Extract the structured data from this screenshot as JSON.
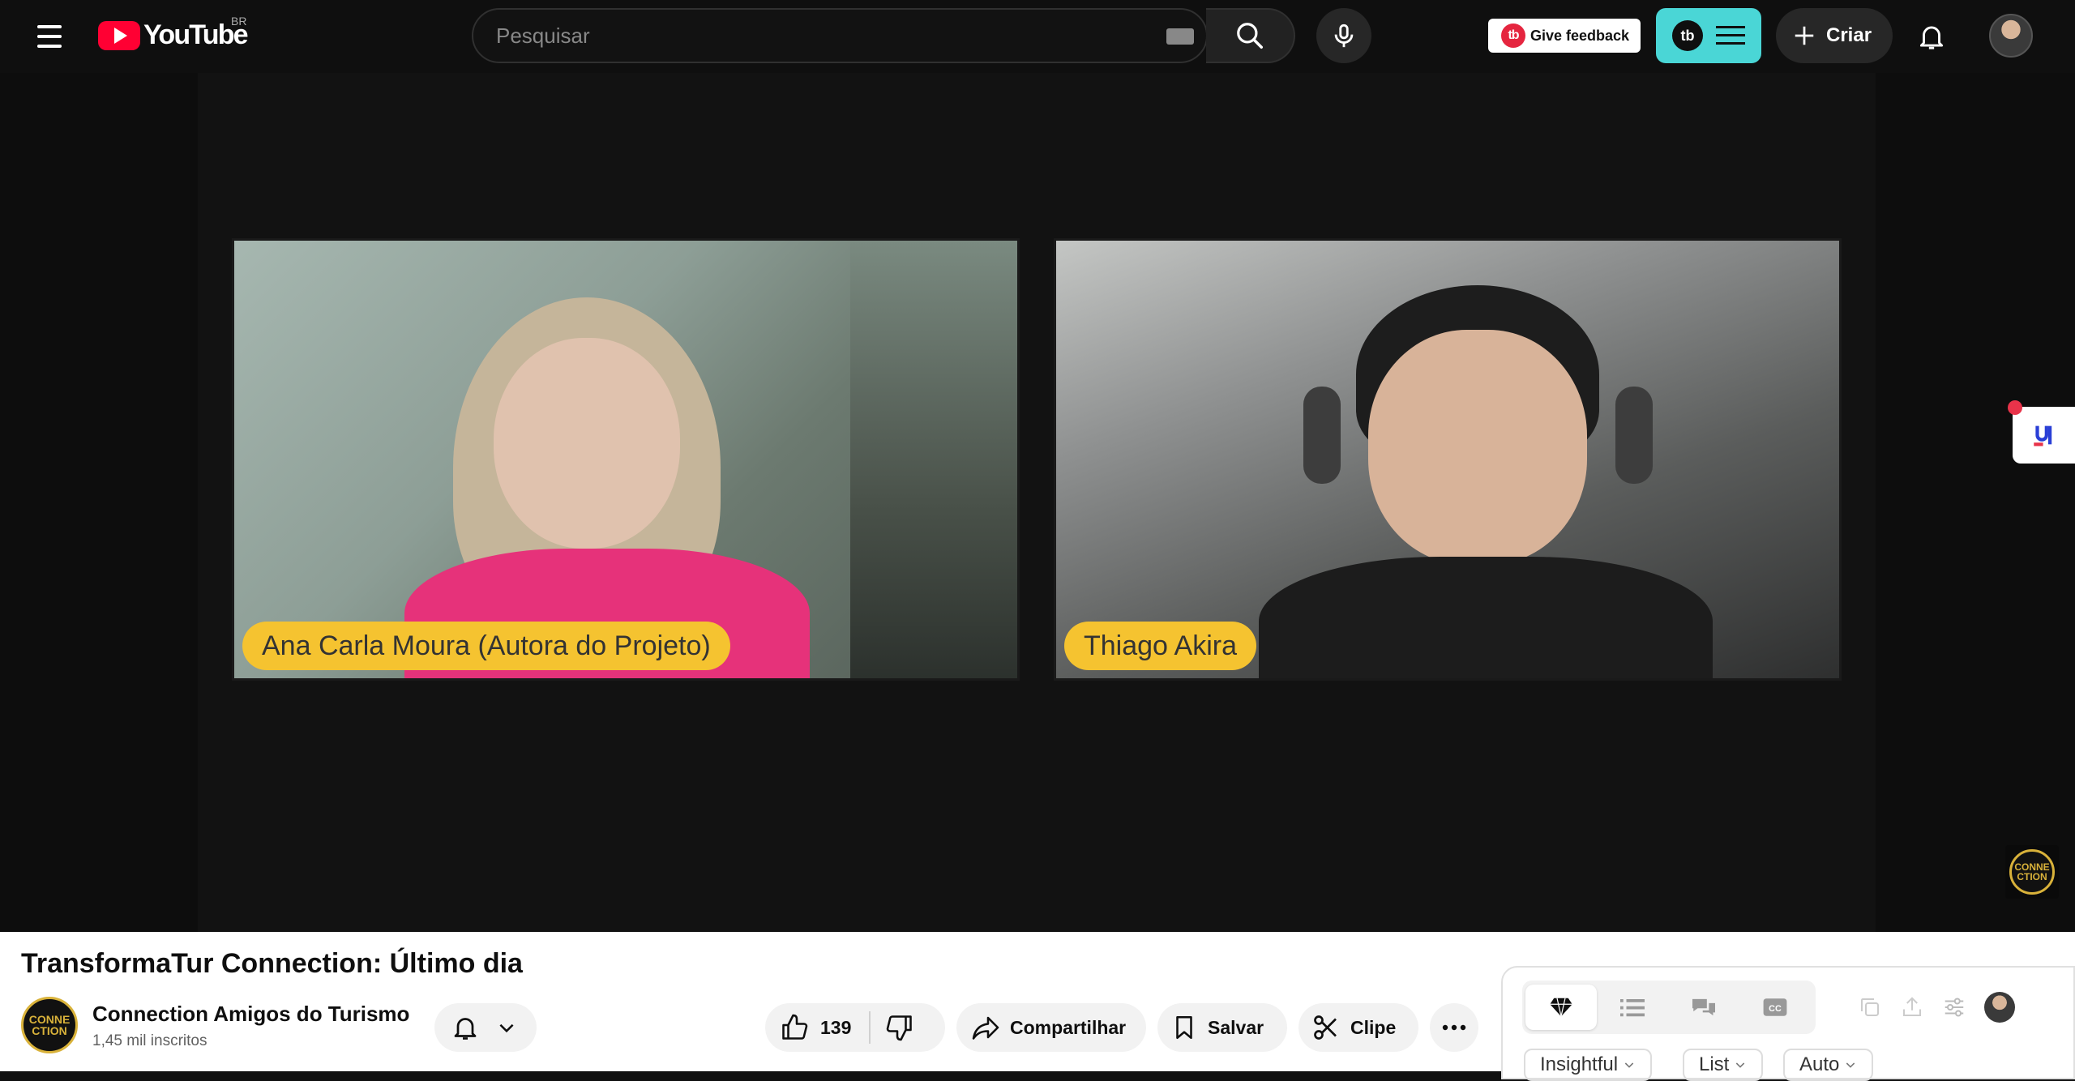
{
  "header": {
    "logo_text": "YouTube",
    "country_code": "BR",
    "search_placeholder": "Pesquisar",
    "feedback_label": "Give feedback",
    "tb_badge": "tb",
    "create_label": "Criar"
  },
  "video": {
    "speakers": [
      {
        "name": "Ana Carla Moura (Autora do Projeto)"
      },
      {
        "name": "Thiago Akira"
      }
    ],
    "watermark_text": "CONNE CTION",
    "accent_color": "#f5c330"
  },
  "details": {
    "title": "TransformaTur Connection: Último dia",
    "channel_name": "Connection Amigos do Turismo",
    "subscribers": "1,45 mil inscritos",
    "channel_avatar_text": "CONNE CTION",
    "likes": "139",
    "share_label": "Compartilhar",
    "save_label": "Salvar",
    "clip_label": "Clipe"
  },
  "side_panel": {
    "tabs": [
      "gem-icon",
      "list-icon",
      "chat-icon",
      "cc-icon"
    ],
    "chips": [
      "Insightful",
      "List",
      "Auto"
    ]
  },
  "colors": {
    "brand_red": "#ff0033",
    "teal": "#4ad6d6",
    "badge_red": "#e5253f"
  }
}
